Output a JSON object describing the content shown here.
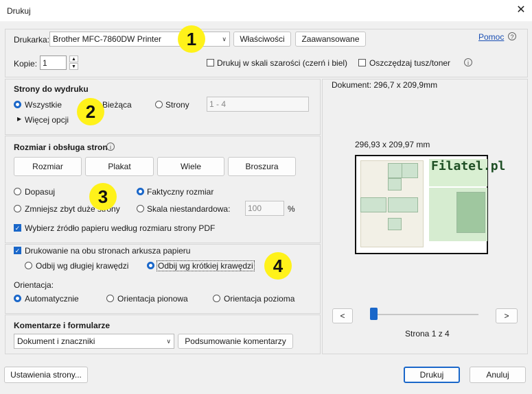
{
  "window": {
    "title": "Drukuj",
    "close_icon": "close-icon"
  },
  "printer": {
    "label": "Drukarka:",
    "selected": "Brother MFC-7860DW Printer",
    "properties_button": "Właściwości",
    "advanced_button": "Zaawansowane",
    "help_link": "Pomoc",
    "copies_label": "Kopie:",
    "copies_value": "1",
    "grayscale_label": "Drukuj w skali szarości (czerń i biel)",
    "save_ink_label": "Oszczędzaj tusz/toner"
  },
  "pages": {
    "heading": "Strony do wydruku",
    "all": "Wszystkie",
    "current": "Bieżąca",
    "pages_option": "Strony",
    "pages_range_placeholder": "1 - 4",
    "more_options": "Więcej opcji"
  },
  "sizing": {
    "heading": "Rozmiar i obsługa stron",
    "tabs": [
      "Rozmiar",
      "Plakat",
      "Wiele",
      "Broszura"
    ],
    "fit": "Dopasuj",
    "actual": "Faktyczny rozmiar",
    "shrink": "Zmniejsz zbyt duże strony",
    "custom_scale": "Skala niestandardowa:",
    "scale_value": "100",
    "percent": "%",
    "paper_source": "Wybierz źródło papieru według rozmiaru strony PDF"
  },
  "duplex": {
    "label": "Drukowanie na obu stronach arkusza papieru",
    "long_edge": "Odbij wg długiej krawędzi",
    "short_edge": "Odbij wg krótkiej krawędzi"
  },
  "orientation": {
    "label": "Orientacja:",
    "auto": "Automatycznie",
    "portrait": "Orientacja pionowa",
    "landscape": "Orientacja pozioma"
  },
  "comments": {
    "heading": "Komentarze i formularze",
    "selected": "Dokument i znaczniki",
    "summary_button": "Podsumowanie komentarzy"
  },
  "preview": {
    "document_size": "Dokument: 296,7 x 209,9mm",
    "paper_size": "296,93 x 209,97 mm",
    "page_logo": "Filatel.pl",
    "prev": "<",
    "next": ">",
    "page_indicator": "Strona 1 z 4",
    "slider_position": 0
  },
  "footer": {
    "page_setup": "Ustawienia strony...",
    "print": "Drukuj",
    "cancel": "Anuluj"
  },
  "annotations": [
    "1",
    "2",
    "3",
    "4"
  ],
  "colors": {
    "accent": "#1a67c9",
    "bubble": "#fff21a",
    "link": "#1a4fb3"
  }
}
